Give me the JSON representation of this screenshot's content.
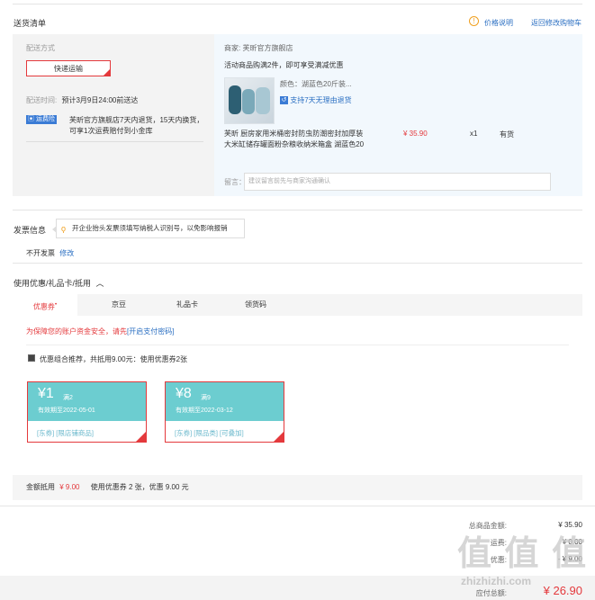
{
  "shipping": {
    "title": "送货清单",
    "price_note_icon": "info-circle-icon",
    "price_note": "价格说明",
    "back_to_cart": "返回修改购物车",
    "method_label": "配送方式",
    "method_value": "快递运输",
    "time_label": "配送时间:",
    "time_value": "预计3月9日24:00前送达",
    "insurance_tag": "运费险",
    "insurance_line1": "芙昕官方旗舰店7天内退货，15天内换货，",
    "insurance_line2": "可享1次运费赔付到小金库",
    "seller": "商家: 芙昕官方旗舰店",
    "promo": "活动商品购满2件，即可享受满减优惠",
    "color": "颜色：湖蓝色20斤装...",
    "return_policy": "支持7天无理由退货",
    "product_line1": "芙昕 厨房家用米桶密封防虫防潮密封加厚装",
    "product_line2": "大米缸储存罐面粉杂粮收纳米箱盒 湖蓝色20",
    "price": "¥ 35.90",
    "qty": "x1",
    "stock": "有货",
    "message_label": "留言：",
    "message_placeholder": "建议留言前先与商家沟通确认"
  },
  "invoice": {
    "title": "发票信息",
    "tip": "开企业抬头发票须填写纳税人识别号，以免影响报销",
    "status": "不开发票",
    "edit": "修改"
  },
  "coupons": {
    "title": "使用优惠/礼品卡/抵用",
    "tabs": [
      "优惠券",
      "京豆",
      "礼品卡",
      "领货码"
    ],
    "security_prefix": "为保障您的账户资金安全，请先",
    "security_link": "[开启支付密码]",
    "combo_text": "优惠组合推荐，共抵用9.00元：使用优惠券2张",
    "items": [
      {
        "amount": "¥1",
        "cond": "满2",
        "expire": "有效期至2022-05-01",
        "tags": "[东券]  [限店铺商品]"
      },
      {
        "amount": "¥8",
        "cond": "满9",
        "expire": "有效期至2022-03-12",
        "tags": "[东券]  [限品类]  [可叠加]"
      }
    ],
    "summary_label": "金额抵用",
    "summary_amount": "¥ 9.00",
    "summary_detail": "使用优惠券 2 张，优惠 9.00 元"
  },
  "totals": {
    "goods_label": "总商品金额:",
    "goods_value": "¥ 35.90",
    "row2_label": "运费:",
    "row2_value": "¥ 0.00",
    "row3_label": "优惠:",
    "row3_value": "- ¥ 9.00",
    "payable_label": "应付总额:",
    "payable_value": "¥ 26.90"
  },
  "watermark": {
    "text": "值 值 值",
    "url": "zhizhizhi.com"
  },
  "colors": {
    "accent_red": "#e4393c",
    "link_blue": "#2b6fc2",
    "coupon_teal": "#6ccdd0"
  }
}
